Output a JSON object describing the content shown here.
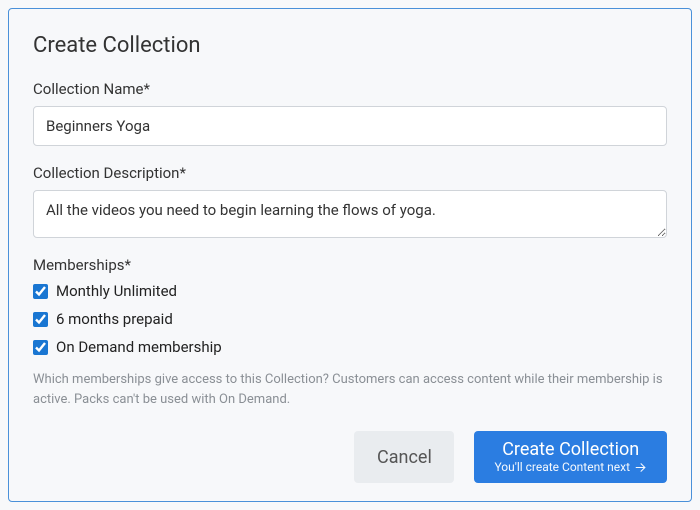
{
  "modal": {
    "title": "Create Collection",
    "name_label": "Collection Name*",
    "name_value": "Beginners Yoga",
    "description_label": "Collection Description*",
    "description_value": "All the videos you need to begin learning the flows of yoga.",
    "memberships_label": "Memberships*",
    "memberships": [
      {
        "label": "Monthly Unlimited",
        "checked": true
      },
      {
        "label": "6 months prepaid",
        "checked": true
      },
      {
        "label": "On Demand membership",
        "checked": true
      }
    ],
    "help_text": "Which memberships give access to this Collection? Customers can access content while their membership is active. Packs can't be used with On Demand.",
    "buttons": {
      "cancel": "Cancel",
      "create": "Create Collection",
      "create_sub": "You'll create Content next"
    }
  },
  "colors": {
    "accent": "#2b7de1",
    "border": "#4a90d9"
  }
}
